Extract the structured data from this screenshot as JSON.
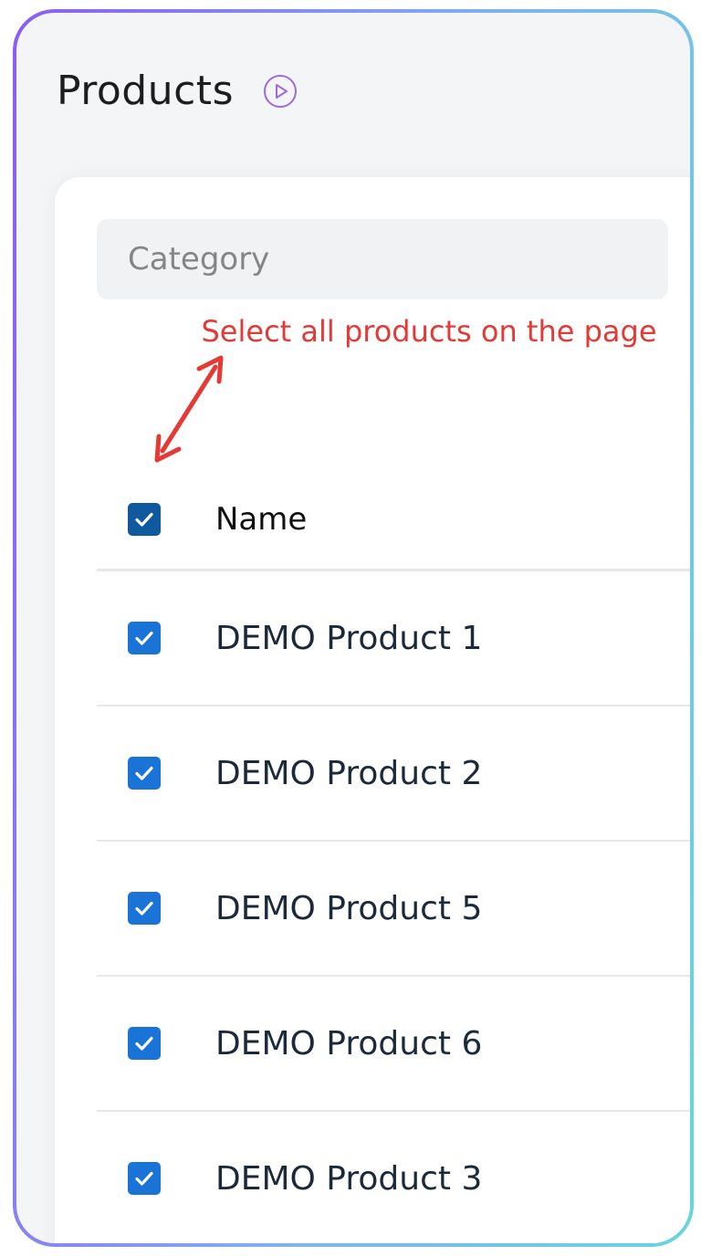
{
  "header": {
    "title": "Products",
    "play_icon": "play-circle-icon"
  },
  "filter": {
    "category_placeholder": "Category"
  },
  "annotation": {
    "text": "Select all products on the page",
    "color": "#e53935"
  },
  "table": {
    "select_all_checked": true,
    "column_header": "Name",
    "rows": [
      {
        "name": "DEMO Product 1",
        "checked": true
      },
      {
        "name": "DEMO Product 2",
        "checked": true
      },
      {
        "name": "DEMO Product 5",
        "checked": true
      },
      {
        "name": "DEMO Product 6",
        "checked": true
      },
      {
        "name": "DEMO Product 3",
        "checked": true
      }
    ]
  },
  "colors": {
    "checkbox": "#1a73d6",
    "accent_gradient": [
      "#8b5cf6",
      "#67d6dc"
    ]
  }
}
